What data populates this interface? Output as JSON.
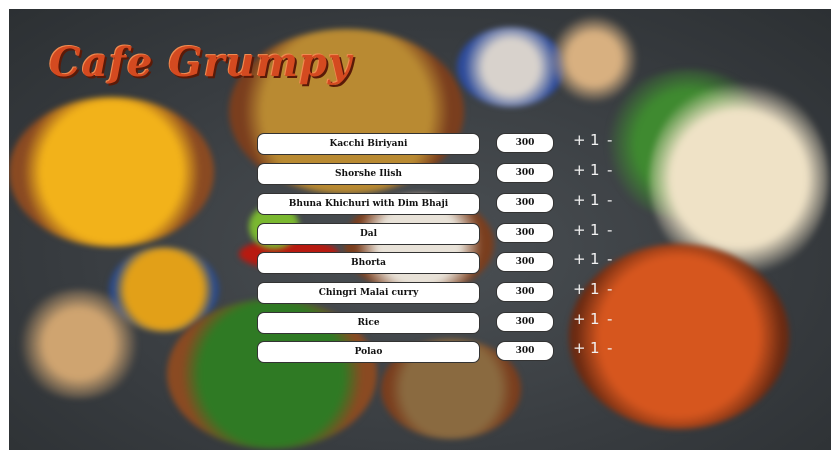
{
  "app": {
    "logo_text": "Cafe Grumpy"
  },
  "controls": {
    "plus": "+",
    "minus": "-"
  },
  "menu": [
    {
      "name": "Kacchi Biriyani",
      "price": "300",
      "qty": "1"
    },
    {
      "name": "Shorshe Ilish",
      "price": "300",
      "qty": "1"
    },
    {
      "name": "Bhuna Khichuri with Dim Bhaji",
      "price": "300",
      "qty": "1"
    },
    {
      "name": "Dal",
      "price": "300",
      "qty": "1"
    },
    {
      "name": "Bhorta",
      "price": "300",
      "qty": "1"
    },
    {
      "name": "Chingri Malai curry",
      "price": "300",
      "qty": "1"
    },
    {
      "name": "Rice",
      "price": "300",
      "qty": "1"
    },
    {
      "name": "Polao",
      "price": "300",
      "qty": "1"
    }
  ]
}
